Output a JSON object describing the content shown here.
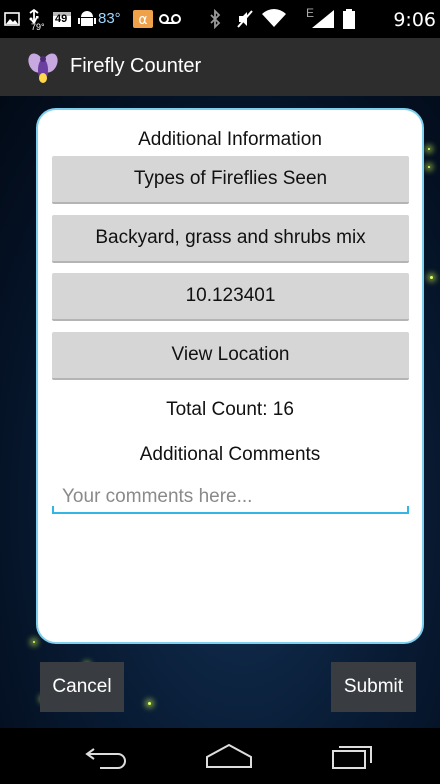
{
  "status_bar": {
    "time": "9:06",
    "temp_small": "79°",
    "badge_49": "49",
    "weather_temp": "83°",
    "network_type": "E",
    "icons": [
      "image-icon",
      "usb-icon",
      "calendar-icon",
      "android-icon",
      "weather-icon",
      "alpha-app-icon",
      "voicemail-icon",
      "bluetooth-icon",
      "mute-icon",
      "wifi-icon",
      "signal-icon",
      "battery-icon"
    ]
  },
  "app_bar": {
    "title": "Firefly Counter",
    "icon": "firefly-icon"
  },
  "dialog": {
    "title": "Additional Information",
    "types_button": "Types of Fireflies Seen",
    "habitat_button": "Backyard, grass and shrubs mix",
    "temperature_button": "10.123401",
    "location_button": "View Location",
    "total_count_label": "Total Count:",
    "total_count_value": "16",
    "comments_heading": "Additional Comments",
    "comments_placeholder": "Your comments here...",
    "comments_value": ""
  },
  "actions": {
    "cancel_label": "Cancel",
    "submit_label": "Submit"
  },
  "nav_bar": {
    "icons": [
      "back-icon",
      "home-icon",
      "recent-apps-icon"
    ]
  },
  "colors": {
    "accent": "#33b5e5",
    "card_border": "#7fd0ef",
    "button_gray": "#d6d6d6",
    "button_dark": "#393d42",
    "app_bar": "#2d2d2d",
    "firefly": "#e6ff5a"
  }
}
